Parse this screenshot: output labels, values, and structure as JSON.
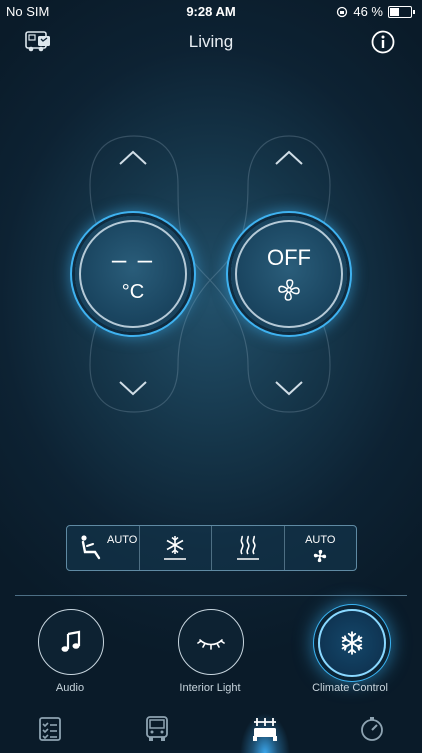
{
  "status_bar": {
    "carrier": "No SIM",
    "time": "9:28 AM",
    "battery": "46 %",
    "battery_level": 0.46
  },
  "header": {
    "title": "Living",
    "left_icon": "vehicle-icon",
    "right_icon": "info-icon"
  },
  "temperature_dial": {
    "value": "– –",
    "unit": "°C"
  },
  "fan_dial": {
    "value": "OFF",
    "icon": "fan-icon"
  },
  "modes": [
    {
      "label": "AUTO",
      "icon": "seat-icon"
    },
    {
      "label": "",
      "icon": "snowflake-icon"
    },
    {
      "label": "",
      "icon": "heat-icon"
    },
    {
      "label": "AUTO",
      "icon": "fan-icon"
    }
  ],
  "bottom_buttons": [
    {
      "label": "Audio",
      "icon": "music-note-icon",
      "active": false
    },
    {
      "label": "Interior Light",
      "icon": "eye-light-icon",
      "active": false
    },
    {
      "label": "Climate Control",
      "icon": "snowflake-icon",
      "active": true
    }
  ],
  "tabs": [
    {
      "icon": "checklist-icon"
    },
    {
      "icon": "vehicle-front-icon"
    },
    {
      "icon": "interior-icon",
      "active": true
    },
    {
      "icon": "gauge-icon"
    }
  ],
  "colors": {
    "accent": "#3fb2f0",
    "background": "#0d2233"
  }
}
